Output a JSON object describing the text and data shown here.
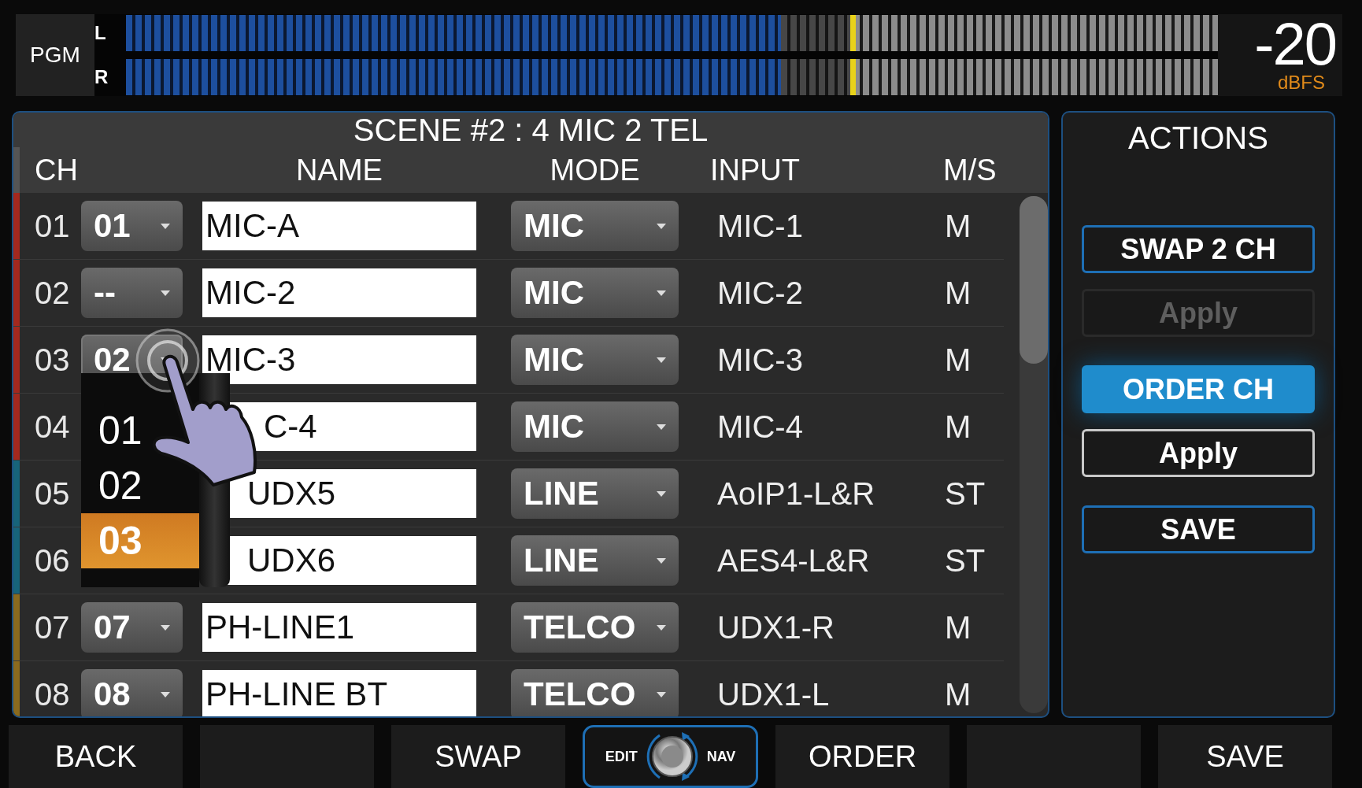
{
  "meter": {
    "label": "PGM",
    "channels": [
      {
        "label": "L",
        "level": 0.6,
        "peak": {
          "level": 0.663
        }
      },
      {
        "label": "R",
        "level": 0.6,
        "peak": {
          "level": 0.663
        }
      }
    ],
    "readout": "-20",
    "unit": "dBFS"
  },
  "scene": {
    "title": "SCENE #2 : 4 MIC 2 TEL",
    "columns": [
      "CH",
      "NAME",
      "MODE",
      "INPUT",
      "M/S"
    ],
    "rows": [
      {
        "ch": "01",
        "assign": "01",
        "dropdown_open": false,
        "name": "MIC-A",
        "mode": "MIC",
        "input": "MIC-1",
        "ms": "M",
        "color": "#a3281e"
      },
      {
        "ch": "02",
        "assign": "--",
        "dropdown_open": false,
        "name": "MIC-2",
        "mode": "MIC",
        "input": "MIC-2",
        "ms": "M",
        "color": "#a3281e"
      },
      {
        "ch": "03",
        "assign": "02",
        "dropdown_open": true,
        "name": "MIC-3",
        "mode": "MIC",
        "input": "MIC-3",
        "ms": "M",
        "color": "#a3281e"
      },
      {
        "ch": "04",
        "assign": "",
        "dropdown_open": false,
        "name": "C-4",
        "mode": "MIC",
        "input": "MIC-4",
        "ms": "M",
        "color": "#a3281e"
      },
      {
        "ch": "05",
        "assign": "",
        "dropdown_open": false,
        "name": "UDX5",
        "mode": "LINE",
        "input": "AoIP1-L&R",
        "ms": "ST",
        "color": "#17647a"
      },
      {
        "ch": "06",
        "assign": "",
        "dropdown_open": false,
        "name": "UDX6",
        "mode": "LINE",
        "input": "AES4-L&R",
        "ms": "ST",
        "color": "#17647a"
      },
      {
        "ch": "07",
        "assign": "07",
        "dropdown_open": false,
        "name": "PH-LINE1",
        "mode": "TELCO",
        "input": "UDX1-R",
        "ms": "M",
        "color": "#8a6a1e"
      },
      {
        "ch": "08",
        "assign": "08",
        "dropdown_open": false,
        "name": "PH-LINE BT",
        "mode": "TELCO",
        "input": "UDX1-L",
        "ms": "M",
        "color": "#8a6a1e"
      }
    ],
    "assign_menu": {
      "options": [
        {
          "label": "01",
          "selected": false
        },
        {
          "label": "02",
          "selected": false
        },
        {
          "label": "03",
          "selected": true
        }
      ]
    }
  },
  "actions": {
    "title": "ACTIONS",
    "buttons": [
      {
        "label": "SWAP 2 CH",
        "kind": "action",
        "disabled": false,
        "selected": false
      },
      {
        "label": "Apply",
        "kind": "apply",
        "disabled": true,
        "selected": false
      },
      {
        "label": "ORDER CH",
        "kind": "action",
        "disabled": false,
        "selected": true
      },
      {
        "label": "Apply",
        "kind": "apply",
        "disabled": false,
        "selected": false
      },
      {
        "label": "SAVE",
        "kind": "action",
        "disabled": false,
        "selected": false
      }
    ]
  },
  "bottom_bar": [
    {
      "kind": "button",
      "label": "BACK"
    },
    {
      "kind": "blank"
    },
    {
      "kind": "button",
      "label": "SWAP"
    },
    {
      "kind": "knob",
      "left": "EDIT",
      "right": "NAV"
    },
    {
      "kind": "button",
      "label": "ORDER"
    },
    {
      "kind": "blank"
    },
    {
      "kind": "button",
      "label": "SAVE"
    }
  ]
}
